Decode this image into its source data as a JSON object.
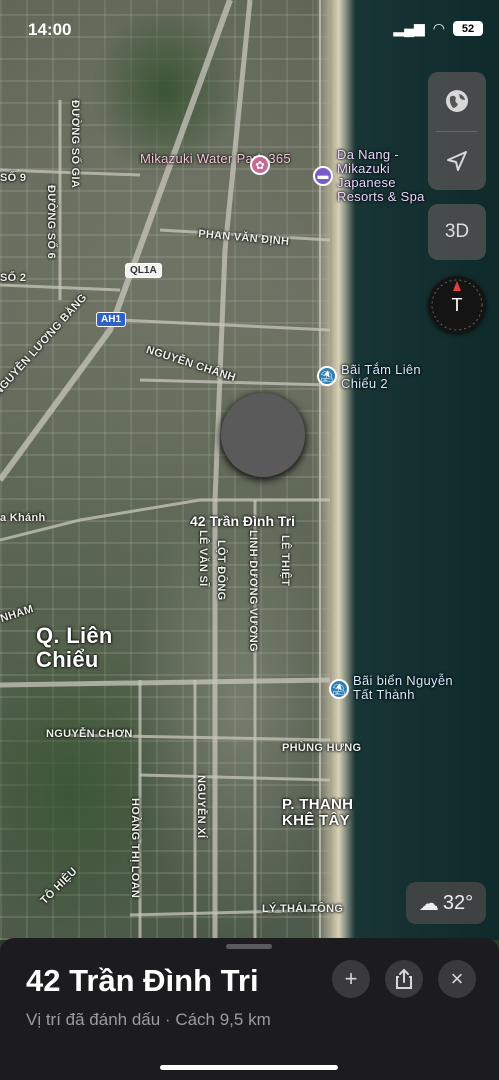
{
  "status_bar": {
    "time": "14:00",
    "battery": "52"
  },
  "map": {
    "labels": {
      "park": "Mikazuki Water Park 365",
      "resort": "Da Nang - Mikazuki Japanese Resorts & Spa",
      "phan_van_dinh": "PHAN VĂN ĐỊNH",
      "ql1a": "QL1A",
      "ah1": "AH1",
      "nguyen_luong_bang": "NGUYỄN LƯƠNG BẰNG",
      "nguyen_chanh": "NGUYỄN CHÁNH",
      "beach1": "Bãi Tắm Liên Chiểu 2",
      "so9": "SỐ 9",
      "so6": "ĐƯỜNG SỐ 6",
      "so2": "SỐ 2",
      "so_gia": "ĐƯỜNG SỐ GIA",
      "a_khanh": "a Khánh",
      "nham": "NHAM",
      "district": "Q. Liên Chiểu",
      "le_van_si": "LÊ VĂN SĨ",
      "lot_dong": "LỘT ĐÔNG",
      "linh_duong_vuong": "LINH DƯƠNG VƯƠNG",
      "le_thiet": "LÊ THIỆT",
      "beach2": "Bãi biển Nguyễn Tất Thành",
      "nguyen_chon": "NGUYỄN CHƠN",
      "phung_hung": "PHÙNG HƯNG",
      "ward": "P. THANH KHÊ TÂY",
      "nguyen_xi": "NGUYỄN XÍ",
      "hoang_thi_loan": "HOÀNG THỊ LOAN",
      "to_hieu": "TÔ HIỆU",
      "ly_thai_tong": "LÝ THÁI TÔNG"
    },
    "pin_label": "42 Trần Đình Tri"
  },
  "controls": {
    "globe_icon": "globe-icon",
    "location_icon": "location-arrow-icon",
    "three_d": "3D",
    "compass_letter": "T",
    "temperature": "32°"
  },
  "sheet": {
    "title": "42 Trần Đình Tri",
    "subtitle": "Vị trí đã đánh dấu · Cách 9,5 km",
    "add_label": "+",
    "share_icon": "share-icon",
    "close_label": "×"
  }
}
